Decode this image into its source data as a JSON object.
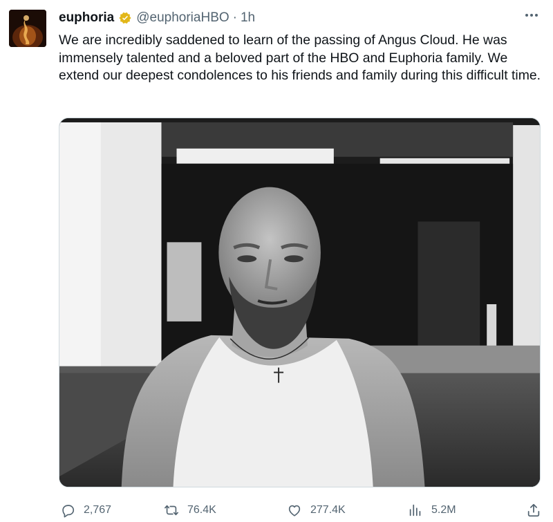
{
  "tweet": {
    "author_name": "euphoria",
    "handle": "@euphoriaHBO",
    "separator": "·",
    "time": "1h",
    "text": "We are incredibly saddened to learn of the passing of Angus Cloud. He was immensely talented and a beloved part of the HBO and Euphoria family. We extend our deepest condolences to his friends and family during this difficult time.",
    "verified_icon": "verified-badge-icon",
    "verified_color": "#e2b719"
  },
  "actions": {
    "replies": "2,767",
    "retweets": "76.4K",
    "likes": "277.4K",
    "views": "5.2M"
  },
  "colors": {
    "text_primary": "#0f1419",
    "text_secondary": "#536471",
    "border": "#cfd9de"
  }
}
